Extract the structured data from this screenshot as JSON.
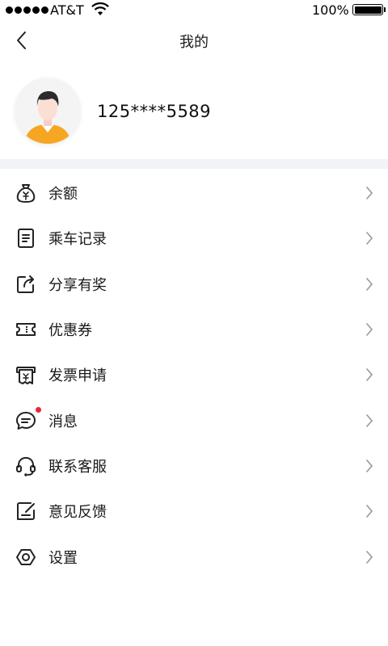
{
  "status_bar": {
    "carrier": "AT&T",
    "battery_percent": "100%",
    "signal_bars": 5
  },
  "nav": {
    "title": "我的"
  },
  "profile": {
    "phone": "125****5589"
  },
  "menu": {
    "items": [
      {
        "label": "余额",
        "icon": "money-bag-icon"
      },
      {
        "label": "乘车记录",
        "icon": "document-icon"
      },
      {
        "label": "分享有奖",
        "icon": "share-icon"
      },
      {
        "label": "优惠券",
        "icon": "ticket-icon"
      },
      {
        "label": "发票申请",
        "icon": "invoice-icon"
      },
      {
        "label": "消息",
        "icon": "message-icon",
        "unread": true
      },
      {
        "label": "联系客服",
        "icon": "headset-icon"
      },
      {
        "label": "意见反馈",
        "icon": "feedback-icon"
      },
      {
        "label": "设置",
        "icon": "settings-icon"
      }
    ]
  },
  "colors": {
    "section_divider": "#f2f3f7",
    "badge": "#e8253b",
    "avatar_shirt": "#f5a623"
  }
}
